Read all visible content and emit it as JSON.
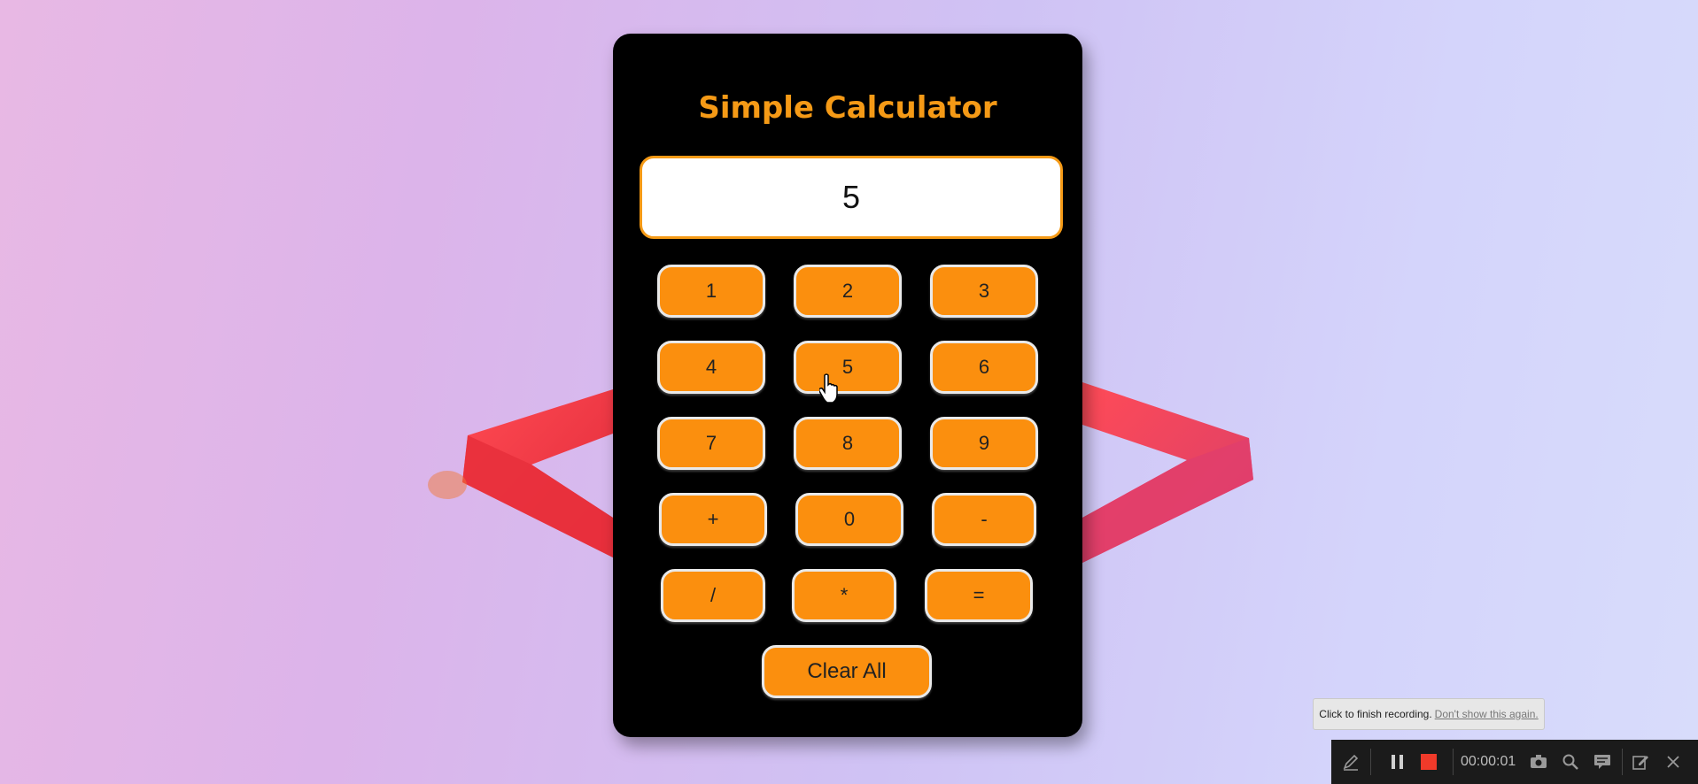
{
  "calculator": {
    "title": "Simple Calculator",
    "display_value": "5",
    "accent_color": "#f59a16",
    "button_color": "#fb8f0e",
    "keys": {
      "k1": "1",
      "k2": "2",
      "k3": "3",
      "k4": "4",
      "k5": "5",
      "k6": "6",
      "k7": "7",
      "k8": "8",
      "k9": "9",
      "plus": "+",
      "k0": "0",
      "minus": "-",
      "divide": "/",
      "multiply": "*",
      "equals": "=",
      "clear": "Clear All"
    }
  },
  "recorder": {
    "tooltip_text": "Click to finish recording.",
    "tooltip_link": "Don't show this again.",
    "timer": "00:00:01",
    "icons": [
      "pen-icon",
      "pause-icon",
      "stop-icon",
      "camera-icon",
      "zoom-icon",
      "captions-icon",
      "edit-icon",
      "close-icon"
    ]
  }
}
